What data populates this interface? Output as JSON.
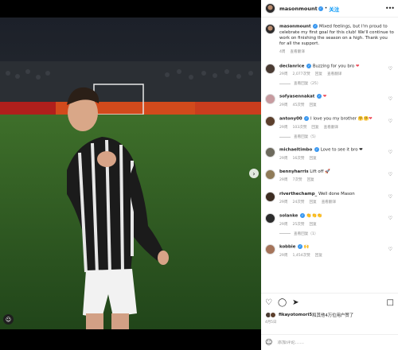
{
  "post": {
    "username": "masonmount",
    "follow_label": "关注",
    "more_icon": "more-horizontal-icon"
  },
  "caption": {
    "username": "masonmount",
    "text": "Mixed feelings, but I'm proud to celebrate my first goal for this club! We'll continue to work on finishing the season on a high. Thank you for all the support.",
    "time": "4周",
    "translate": "查看翻译"
  },
  "comments": [
    {
      "username": "declanrice",
      "text": "Buzzing for you bro",
      "time": "29周",
      "likes": "2,077次赞",
      "reply": "回复",
      "translate": "查看翻译",
      "replies": "查看回复（25）"
    },
    {
      "username": "sofyasennakat",
      "text": "",
      "time": "29周",
      "likes": "45次赞",
      "reply": "回复",
      "translate": ""
    },
    {
      "username": "antony00",
      "text": "I love you my brother",
      "time": "29周",
      "likes": "103次赞",
      "reply": "回复",
      "translate": "查看翻译",
      "replies": "查看回复（5）"
    },
    {
      "username": "michaeltimbo",
      "text": "Love to see it bro",
      "time": "29周",
      "likes": "16次赞",
      "reply": "回复",
      "translate": ""
    },
    {
      "username": "bennyharris",
      "text": "Lift off",
      "time": "29周",
      "likes": "7次赞",
      "reply": "回复",
      "translate": ""
    },
    {
      "username": "riverthechamp_",
      "text": "Well done Mason",
      "time": "29周",
      "likes": "24次赞",
      "reply": "回复",
      "translate": "查看翻译"
    },
    {
      "username": "solanke",
      "text": "",
      "time": "29周",
      "likes": "25次赞",
      "reply": "回复",
      "translate": "",
      "replies": "查看回复（1）"
    },
    {
      "username": "kobbie",
      "text": "",
      "time": "29周",
      "likes": "1,454次赞",
      "reply": "回复",
      "translate": ""
    }
  ],
  "likes_summary": {
    "user": "fikayotomori5",
    "text": "和其他4万位用户",
    "suffix": "赞了"
  },
  "post_time": "4月5日",
  "comment_box": {
    "placeholder": "添加评论……"
  }
}
